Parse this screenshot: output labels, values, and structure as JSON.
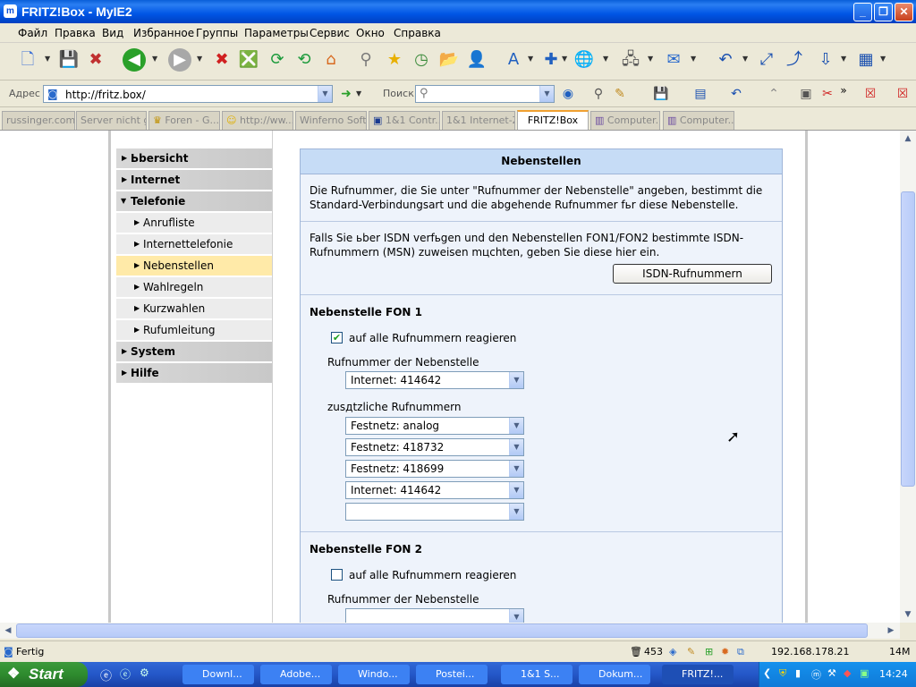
{
  "window": {
    "title": "FRITZ!Box - MyIE2",
    "app_icon_glyph": "m"
  },
  "menu": [
    "Файл",
    "Правка",
    "Вид",
    "Избранное",
    "Группы",
    "Параметры",
    "Сервис",
    "Окно",
    "Справка"
  ],
  "address": {
    "label": "Адрес",
    "url": "http://fritz.box/",
    "search_label": "Поиск"
  },
  "tabs": [
    "russinger.com ...",
    "Server nicht g...",
    "Foren - G...",
    "http://ww...",
    "Winferno Soft...",
    "1&1 Contr...",
    "1&1 Internet-Z...",
    "FRITZ!Box",
    "Computer...",
    "Computer..."
  ],
  "active_tab": "FRITZ!Box",
  "nav": {
    "items": [
      {
        "label": "Ьbersicht",
        "level": "top"
      },
      {
        "label": "Internet",
        "level": "top"
      },
      {
        "label": "Telefonie",
        "level": "top",
        "expanded": true
      },
      {
        "label": "Anrufliste",
        "level": "sub"
      },
      {
        "label": "Internettelefonie",
        "level": "sub"
      },
      {
        "label": "Nebenstellen",
        "level": "sub",
        "selected": true
      },
      {
        "label": "Wahlregeln",
        "level": "sub"
      },
      {
        "label": "Kurzwahlen",
        "level": "sub"
      },
      {
        "label": "Rufumleitung",
        "level": "sub"
      },
      {
        "label": "System",
        "level": "top"
      },
      {
        "label": "Hilfe",
        "level": "top"
      }
    ]
  },
  "panel": {
    "title": "Nebenstellen",
    "intro_line1": "Die Rufnummer, die Sie unter \"Rufnummer der Nebenstelle\" angeben, bestimmt die",
    "intro_line2": "Standard-Verbindungsart und die abgehende Rufnummer fьr diese Nebenstelle.",
    "isdn_line1": "Falls Sie ьber ISDN verfьgen und den Nebenstellen FON1/FON2 bestimmte ISDN-",
    "isdn_line2": "Rufnummern (MSN) zuweisen mцchten, geben Sie diese hier ein.",
    "isdn_button": "ISDN-Rufnummern",
    "fon1": {
      "heading": "Nebenstelle FON 1",
      "check_label": "auf alle Rufnummern reagieren",
      "checked": true,
      "main_label": "Rufnummer der Nebenstelle",
      "main_value": "Internet: 414642",
      "extra_label": "zusдtzliche Rufnummern",
      "extra_values": [
        "Festnetz: analog",
        "Festnetz: 418732",
        "Festnetz: 418699",
        "Internet: 414642",
        ""
      ]
    },
    "fon2": {
      "heading": "Nebenstelle FON 2",
      "check_label": "auf alle Rufnummern reagieren",
      "checked": false,
      "main_label": "Rufnummer der Nebenstelle",
      "main_value": ""
    }
  },
  "status": {
    "text": "Fertig",
    "count": "453",
    "ip": "192.168.178.21",
    "mem": "14M"
  },
  "taskbar": {
    "start": "Start",
    "tasks": [
      "Downl...",
      "Adobe...",
      "Windo...",
      "Postei...",
      "1&1 S...",
      "Dokum...",
      "FRITZ!..."
    ],
    "active_task": "FRITZ!...",
    "clock": "14:24"
  },
  "colors": {
    "titlebar": "#0055e5",
    "selected_nav": "#ffeaa8",
    "panel_head": "#c6dcf6",
    "taskbar": "#2457c8",
    "start": "#2e8b2e"
  }
}
